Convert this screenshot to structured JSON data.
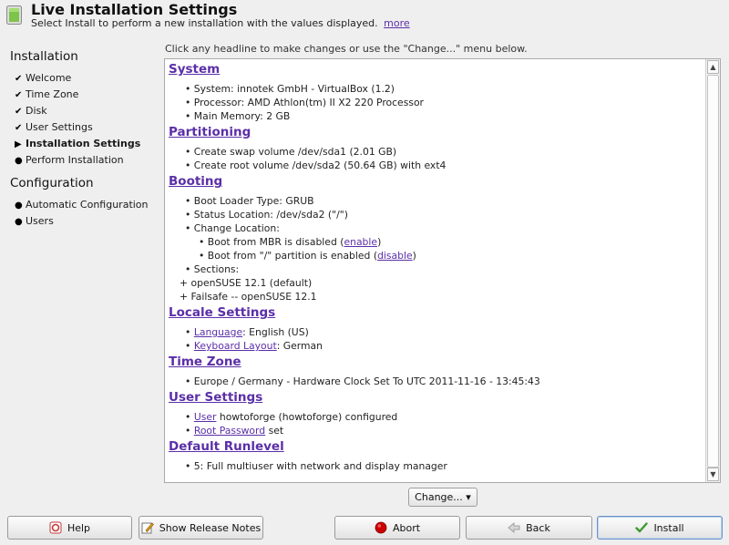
{
  "header": {
    "title": "Live Installation Settings",
    "subtitle": "Select Install to perform a new installation with the values displayed.",
    "more_link": "more"
  },
  "sidebar": {
    "sections": [
      {
        "title": "Installation"
      },
      {
        "title": "Configuration"
      }
    ],
    "installation_steps": [
      {
        "label": "Welcome",
        "mark": "✔"
      },
      {
        "label": "Time Zone",
        "mark": "✔"
      },
      {
        "label": "Disk",
        "mark": "✔"
      },
      {
        "label": "User Settings",
        "mark": "✔"
      },
      {
        "label": "Installation Settings",
        "mark": "▶"
      },
      {
        "label": "Perform Installation",
        "mark": "●"
      }
    ],
    "configuration_steps": [
      {
        "label": "Automatic Configuration",
        "mark": "●"
      },
      {
        "label": "Users",
        "mark": "●"
      }
    ]
  },
  "main": {
    "hint": "Click any headline to make changes or use the \"Change...\" menu below.",
    "sections": {
      "system": {
        "heading": "System",
        "lines": [
          "• System: innotek GmbH - VirtualBox (1.2)",
          "• Processor: AMD Athlon(tm) II X2 220 Processor",
          "• Main Memory: 2 GB"
        ]
      },
      "partitioning": {
        "heading": "Partitioning",
        "lines": [
          "• Create swap volume /dev/sda1 (2.01 GB)",
          "• Create root volume /dev/sda2 (50.64 GB) with ext4"
        ]
      },
      "booting": {
        "heading": "Booting",
        "line1": "• Boot Loader Type: GRUB",
        "line2": "• Status Location: /dev/sda2 (\"/\")",
        "line3": "• Change Location:",
        "mbr_text": "• Boot from MBR is disabled (",
        "mbr_link": "enable",
        "part_text": "• Boot from \"/\" partition is enabled (",
        "part_link": "disable",
        "close_paren": ")",
        "line6": "• Sections:",
        "line7": "+ openSUSE 12.1 (default)",
        "line8": "+ Failsafe -- openSUSE 12.1"
      },
      "locale": {
        "heading": "Locale Settings",
        "bullet": "• ",
        "language_link": "Language",
        "language_value": ": English (US)",
        "keyboard_link": "Keyboard Layout",
        "keyboard_value": ": German"
      },
      "timezone": {
        "heading": "Time Zone",
        "line": "• Europe / Germany - Hardware Clock Set To UTC 2011-11-16 - 13:45:43"
      },
      "user": {
        "heading": "User Settings",
        "bullet": "• ",
        "user_link": "User",
        "user_value": " howtoforge (howtoforge) configured",
        "root_link": "Root Password",
        "root_value": " set"
      },
      "runlevel": {
        "heading": "Default Runlevel",
        "line": "• 5: Full multiuser with network and display manager"
      }
    },
    "change_button": "Change...",
    "change_arrow": "▾"
  },
  "buttons": {
    "help": "Help",
    "release_notes": "Show Release Notes",
    "abort": "Abort",
    "back": "Back",
    "install": "Install"
  },
  "colors": {
    "link": "#5b2fa8",
    "abort_icon": "#cc0000",
    "install_icon": "#3d9a2f"
  }
}
